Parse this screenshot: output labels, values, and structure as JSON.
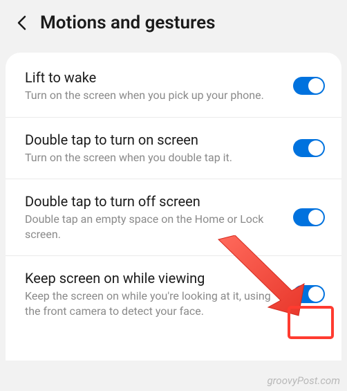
{
  "header": {
    "title": "Motions and gestures"
  },
  "settings": [
    {
      "title": "Lift to wake",
      "desc": "Turn on the screen when you pick up your phone.",
      "enabled": true
    },
    {
      "title": "Double tap to turn on screen",
      "desc": "Turn on the screen when you double tap it.",
      "enabled": true
    },
    {
      "title": "Double tap to turn off screen",
      "desc": "Double tap an empty space on the Home or Lock screen.",
      "enabled": true
    },
    {
      "title": "Keep screen on while viewing",
      "desc": "Keep the screen on while you're looking at it, using the front camera to detect your face.",
      "enabled": true
    }
  ],
  "watermark": "groovyPost.com",
  "annotation": {
    "highlighted_item": "keep-screen-on-toggle",
    "arrow_color": "#ff3b30"
  }
}
